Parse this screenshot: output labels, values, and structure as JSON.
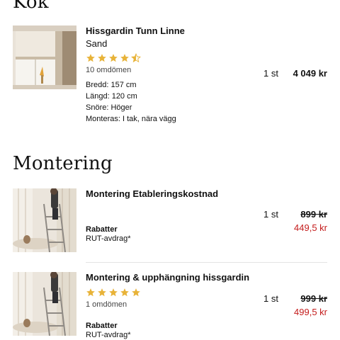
{
  "sections": {
    "kok": {
      "title": "Kök"
    },
    "montering": {
      "title": "Montering"
    }
  },
  "item1": {
    "name": "Hissgardin Tunn Linne",
    "variant": "Sand",
    "rating": 4.5,
    "reviews": "10 omdömen",
    "specs": [
      "Bredd: 157 cm",
      "Längd: 120 cm",
      "Snöre: Höger",
      "Monteras: I tak, nära vägg"
    ],
    "quantity": "1 st",
    "price": "4 049 kr"
  },
  "item2": {
    "name": "Montering Etableringskostnad",
    "discount_label": "Rabatter",
    "discount_text": "RUT-avdrag*",
    "quantity": "1 st",
    "old_price": "899 kr",
    "new_price": "449,5 kr"
  },
  "item3": {
    "name": "Montering & upphängning hissgardin",
    "rating": 5,
    "reviews": "1 omdömen",
    "discount_label": "Rabatter",
    "discount_text": "RUT-avdrag*",
    "quantity": "1 st",
    "old_price": "999 kr",
    "new_price": "499,5 kr"
  },
  "colors": {
    "star": "#e8b339",
    "sale": "#c41c1c",
    "divider": "#e4e4e4"
  }
}
